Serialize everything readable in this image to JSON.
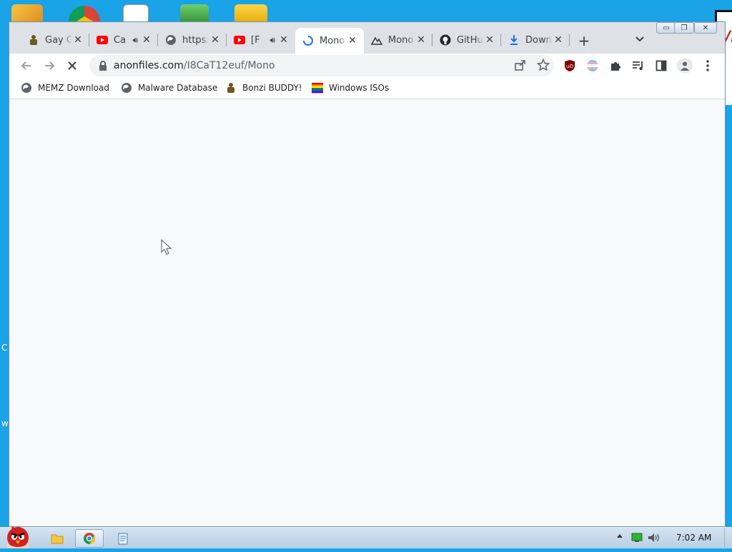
{
  "colors": {
    "desktop": "#1aa3e6",
    "tabstrip": "#dee1e6",
    "youtube_red": "#ff0000",
    "loading_blue": "#1a73e8"
  },
  "desktop": {
    "edge_letters": [
      "C",
      "w"
    ]
  },
  "window": {
    "controls": {
      "minimize": "▭",
      "restore": "❐",
      "close": "✕"
    },
    "tabs": [
      {
        "label": "Gay G",
        "icon": "bonzi-icon",
        "audio": false
      },
      {
        "label": "Ca",
        "icon": "youtube-icon",
        "audio": true
      },
      {
        "label": "https:",
        "icon": "globe-icon",
        "audio": false
      },
      {
        "label": "[F",
        "icon": "youtube-icon",
        "audio": true
      },
      {
        "label": "Mono",
        "icon": "loading-spinner-icon",
        "audio": false,
        "active": true
      },
      {
        "label": "Mono",
        "icon": "mountain-icon",
        "audio": false
      },
      {
        "label": "GitHu",
        "icon": "github-icon",
        "audio": false
      },
      {
        "label": "Down",
        "icon": "download-icon",
        "audio": false
      }
    ],
    "new_tab": "+",
    "address": {
      "domain": "anonfiles.com",
      "path": "/I8CaT12euf/Mono"
    },
    "bookmarks": [
      {
        "label": "MEMZ Download",
        "icon": "globe-icon"
      },
      {
        "label": "Malware Database",
        "icon": "globe-icon"
      },
      {
        "label": "Bonzi BUDDY!",
        "icon": "bonzi-icon"
      },
      {
        "label": "Windows ISOs",
        "icon": "rainbow-flag-icon"
      }
    ]
  },
  "taskbar": {
    "clock": "7:02 AM",
    "pinned": [
      "explorer-icon",
      "chrome-icon",
      "notepad-icon"
    ]
  }
}
